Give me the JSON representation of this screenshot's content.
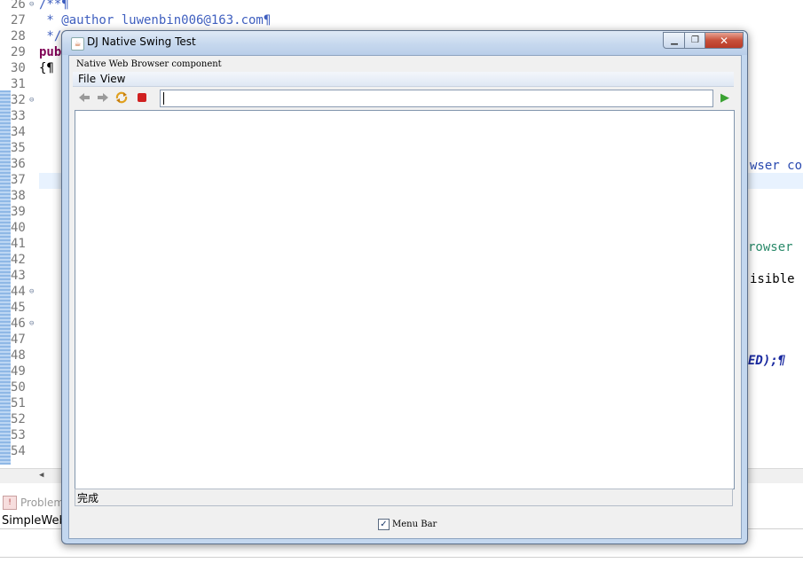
{
  "window": {
    "title": "DJ Native Swing Test",
    "component_label": "Native Web Browser component",
    "menu": [
      "File",
      "View"
    ],
    "url_value": "",
    "status_text": "完成",
    "menu_bar_checkbox": {
      "label": "Menu Bar",
      "checked": true
    },
    "icons": {
      "back": "back-arrow-icon",
      "forward": "forward-arrow-icon",
      "refresh": "refresh-icon",
      "stop": "stop-icon",
      "go": "go-icon"
    }
  },
  "editor": {
    "line_numbers": [
      "26",
      "27",
      "28",
      "29",
      "30",
      "31",
      "32",
      "33",
      "34",
      "35",
      "36",
      "37",
      "38",
      "39",
      "40",
      "41",
      "42",
      "43",
      "44",
      "45",
      "46",
      "47",
      "48",
      "49",
      "50",
      "51",
      "52",
      "53",
      "54"
    ],
    "code_lines": [
      "/**¶",
      " * @author luwenbin006@163.com¶",
      " */",
      "pub",
      "{¶"
    ],
    "right_fragments": [
      "wser co",
      "rowser",
      "isible",
      "ED);¶"
    ]
  },
  "bottom_panel": {
    "problems_tab": "Problem",
    "project_label": "SimpleWebB"
  },
  "colors": {
    "accent": "#3f5fbf",
    "keyword": "#7f0055",
    "go_green": "#3aa232",
    "stop_red": "#d02020"
  }
}
